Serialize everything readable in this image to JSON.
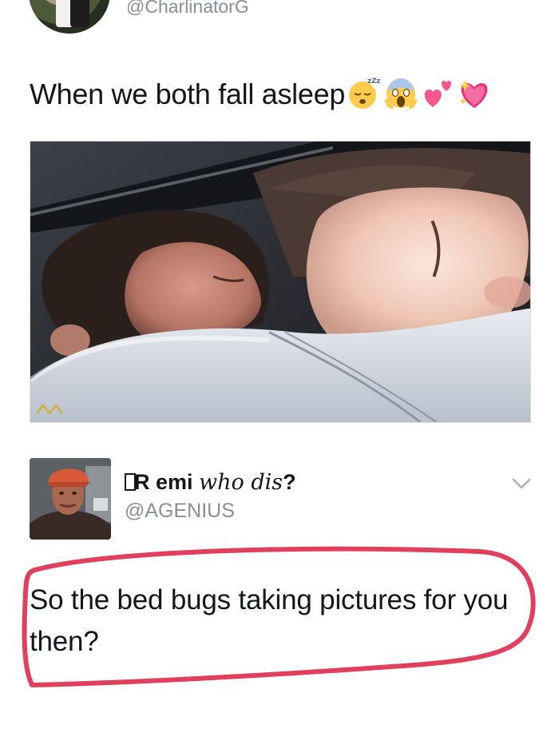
{
  "original_tweet": {
    "handle": "@CharlinatorG",
    "text": "When we both fall asleep",
    "emojis": [
      "sleeping-face",
      "face-screaming-in-fear",
      "revolving-hearts",
      "sparkling-heart"
    ]
  },
  "reply": {
    "name_prefix": "R",
    "name_plain": " emi ",
    "name_fancy": "who dis",
    "name_suffix": "?",
    "handle": "@AGENIUS",
    "text": "So the bed bugs taking pictures for you then?"
  },
  "colors": {
    "handle_gray": "#8a8f94",
    "text_dark": "#14171a",
    "annotation_red": "#e0405e"
  },
  "icons": {
    "menu": "chevron-down-icon"
  }
}
